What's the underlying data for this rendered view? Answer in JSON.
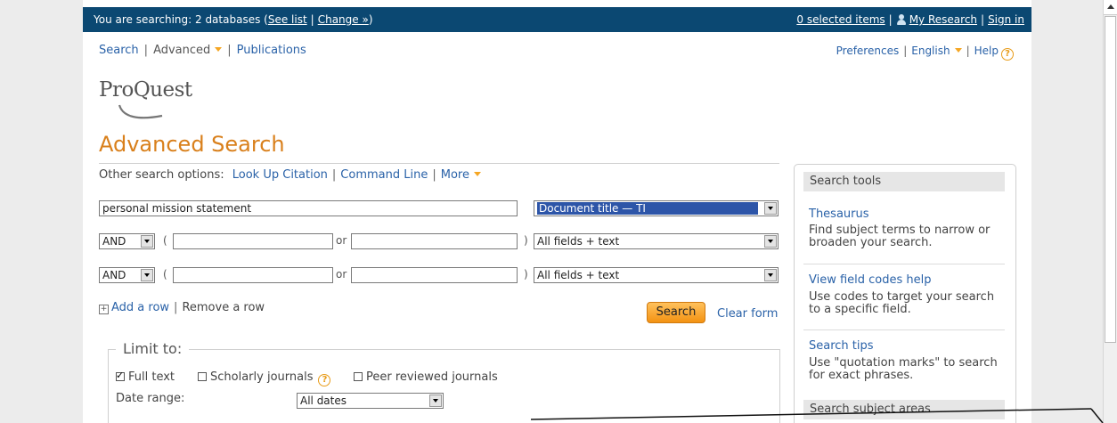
{
  "topbar": {
    "searching_prefix": "You are searching: 2 databases (",
    "see_list": "See list",
    "change": "Change »",
    "suffix": ")",
    "selected_items": "0 selected items",
    "my_research": "My Research",
    "sign_in": "Sign in"
  },
  "nav": {
    "search": "Search",
    "advanced": "Advanced",
    "publications": "Publications",
    "preferences": "Preferences",
    "english": "English",
    "help": "Help"
  },
  "logo": "ProQuest",
  "page_title": "Advanced Search",
  "other_options": {
    "label": "Other search options:",
    "lookup": "Look Up Citation",
    "command": "Command Line",
    "more": "More"
  },
  "rows": [
    {
      "value": "personal mission statement",
      "field": "Document title — TI"
    },
    {
      "op": "AND",
      "or": "or",
      "field": "All fields + text"
    },
    {
      "op": "AND",
      "or": "or",
      "field": "All fields + text"
    }
  ],
  "row_actions": {
    "add": "Add a row",
    "remove": "Remove a row",
    "search": "Search",
    "clear": "Clear form"
  },
  "limit": {
    "legend": "Limit to:",
    "full_text": "Full text",
    "scholarly": "Scholarly journals",
    "peer": "Peer reviewed journals",
    "date_label": "Date range:",
    "date_value": "All dates"
  },
  "tools": {
    "heading": "Search tools",
    "thesaurus": "Thesaurus",
    "thesaurus_desc": "Find subject terms to narrow or broaden your search.",
    "fieldcodes": "View field codes help",
    "fieldcodes_desc": "Use codes to target your search to a specific field.",
    "tips": "Search tips",
    "tips_desc": "Use \"quotation marks\" to search for exact phrases.",
    "subject_heading": "Search subject areas"
  },
  "colors": {
    "topbar": "#0b4872",
    "accent_title": "#d9801c",
    "link": "#2a62a8",
    "button": "#f39212"
  }
}
